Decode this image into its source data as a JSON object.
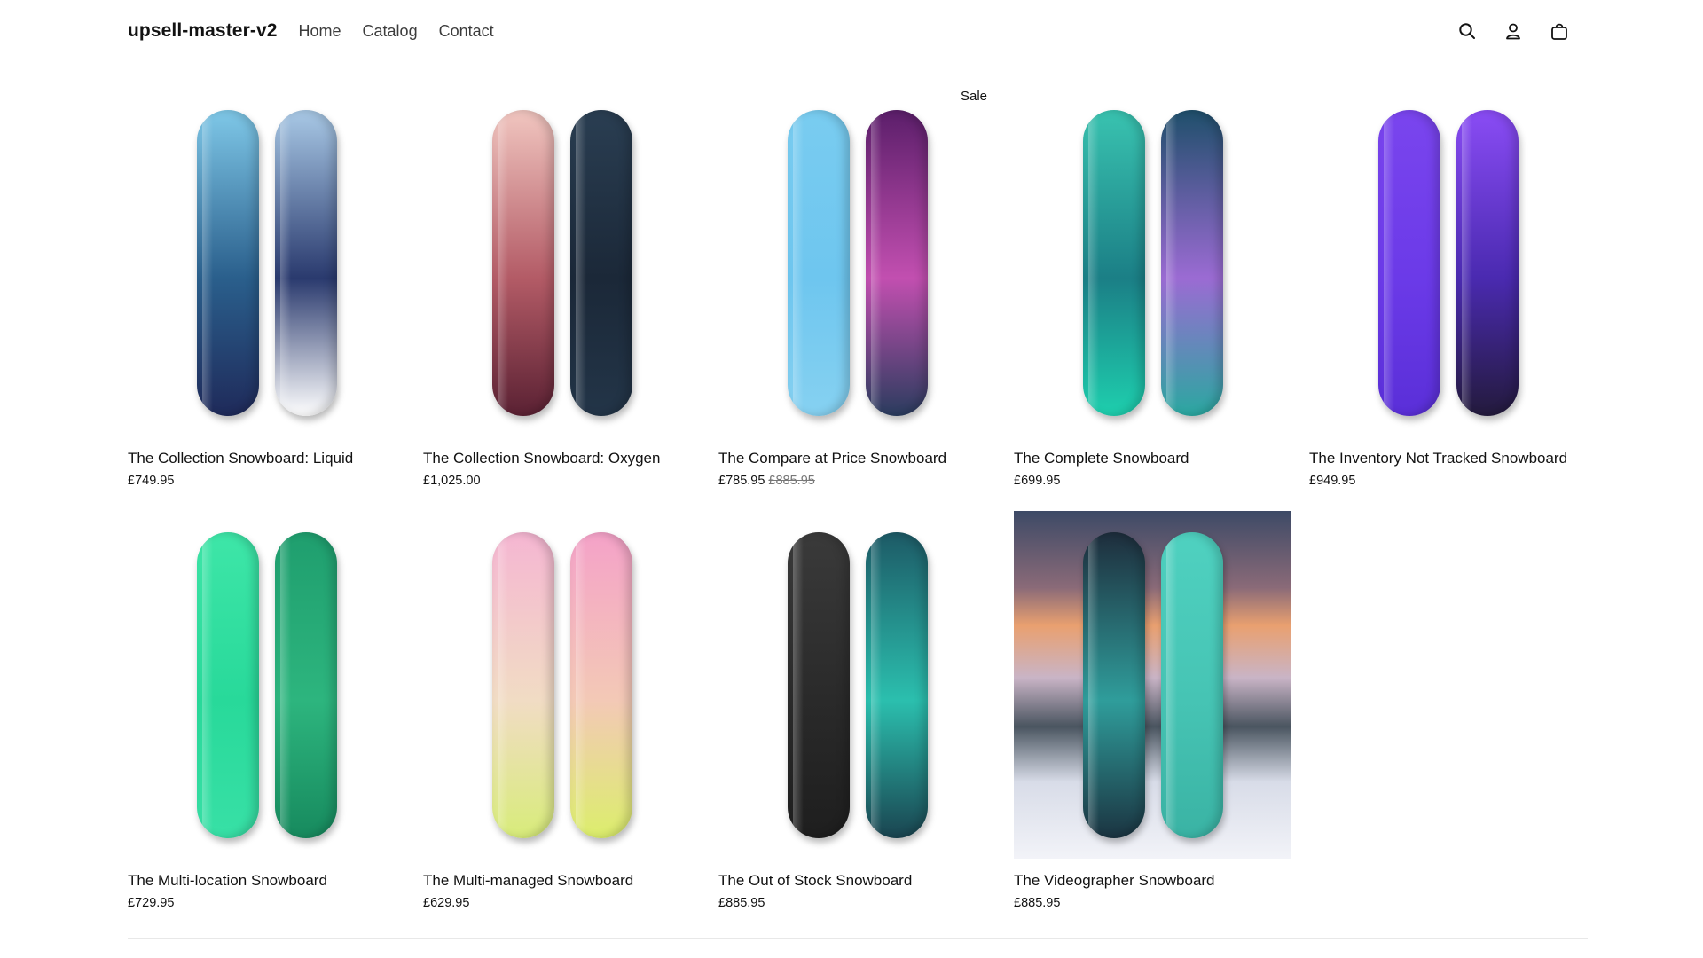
{
  "header": {
    "brand": "upsell-master-v2",
    "nav": [
      "Home",
      "Catalog",
      "Contact"
    ]
  },
  "icons": {
    "search": "search-icon",
    "account": "account-icon",
    "cart": "cart-icon"
  },
  "products": [
    {
      "title": "The Collection Snowboard: Liquid",
      "price": "£749.95",
      "compare": "",
      "boards": [
        [
          "#7fc8e8",
          "#2a5f8c",
          "#1f2a5a"
        ],
        [
          "#a9c9e6",
          "#2a3a6e",
          "#ffffff"
        ]
      ],
      "photo": false,
      "sale": ""
    },
    {
      "title": "The Collection Snowboard: Oxygen",
      "price": "£1,025.00",
      "compare": "",
      "boards": [
        [
          "#f1c6c0",
          "#b35b66",
          "#5a2133"
        ],
        [
          "#2a3e52",
          "#1b2838",
          "#233548"
        ]
      ],
      "photo": false,
      "sale": ""
    },
    {
      "title": "The Compare at Price Snowboard",
      "price": "£785.95",
      "compare": "£885.95",
      "boards": [
        [
          "#79ccf0",
          "#6ec6ef",
          "#86d1f1"
        ],
        [
          "#5b1e6a",
          "#c24fb0",
          "#2a3c5e"
        ]
      ],
      "photo": false,
      "sale": "Sale"
    },
    {
      "title": "The Complete Snowboard",
      "price": "£699.95",
      "compare": "",
      "boards": [
        [
          "#39c3b0",
          "#1b7f86",
          "#1ecfae"
        ],
        [
          "#1f4f6b",
          "#9b6bd3",
          "#2aa8a0"
        ]
      ],
      "photo": false,
      "sale": ""
    },
    {
      "title": "The Inventory Not Tracked Snowboard",
      "price": "£949.95",
      "compare": "",
      "boards": [
        [
          "#7a45ee",
          "#6b3ae8",
          "#5a2fd8"
        ],
        [
          "#8a4cf5",
          "#4a2ab0",
          "#231a3c"
        ]
      ],
      "photo": false,
      "sale": ""
    },
    {
      "title": "The Multi-location Snowboard",
      "price": "£729.95",
      "compare": "",
      "boards": [
        [
          "#3ee6a8",
          "#28d99a",
          "#38e0a6"
        ],
        [
          "#1f9e6e",
          "#2db57e",
          "#178a5e"
        ]
      ],
      "photo": false,
      "sale": ""
    },
    {
      "title": "The Multi-managed Snowboard",
      "price": "£629.95",
      "compare": "",
      "boards": [
        [
          "#f5b6d2",
          "#f1dcc4",
          "#d8ec7a"
        ],
        [
          "#f4a2c8",
          "#f3c9b6",
          "#dcee6c"
        ]
      ],
      "photo": false,
      "sale": ""
    },
    {
      "title": "The Out of Stock Snowboard",
      "price": "£885.95",
      "compare": "",
      "boards": [
        [
          "#3a3a3a",
          "#2a2a2a",
          "#1e1e1e"
        ],
        [
          "#1d5a66",
          "#2bbfae",
          "#1a4450"
        ]
      ],
      "photo": false,
      "sale": ""
    },
    {
      "title": "The Videographer Snowboard",
      "price": "£885.95",
      "compare": "",
      "boards": [
        [
          "#1e2d3c",
          "#2f9d9b",
          "#1b3441"
        ],
        [
          "#4fd1c0",
          "#46c4b4",
          "#3ab3a4"
        ]
      ],
      "photo": true,
      "sale": ""
    }
  ]
}
